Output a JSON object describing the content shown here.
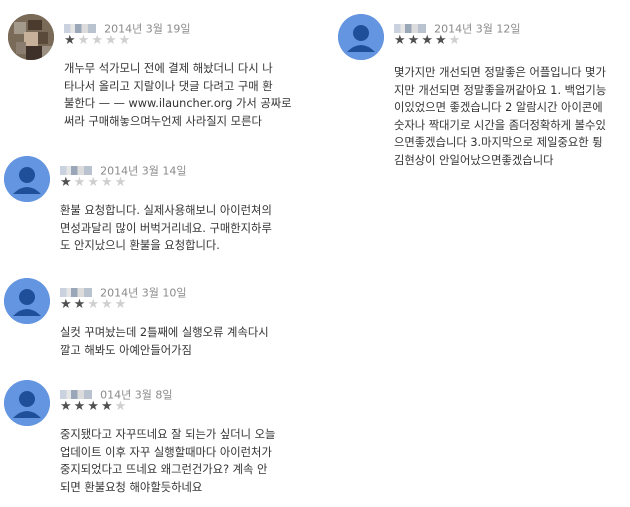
{
  "reviews": [
    {
      "avatar": "photo-avatar",
      "date": "2014년 3월 19일",
      "rating": 1,
      "lines": [
        "개누무 석가모니 전에 결제 해놨더니 다시 나",
        "타나서 올리고 지랄이나 댓글 다려고 구매 환",
        "불한다 — — www.ilauncher.org 가서 공짜로",
        "써라 구매해놓으며누언제 사라질지 모른다"
      ]
    },
    {
      "avatar": "default-user-avatar",
      "date": "2014년 3월 14일",
      "rating": 1,
      "lines": [
        "환불 요청합니다. 실제사용해보니 아이런쳐의",
        "면성과달리 많이 버벅거리네요. 구매한지하루",
        "도 안지났으니 환불을 요청합니다."
      ]
    },
    {
      "avatar": "default-user-avatar",
      "date": "2014년 3월 10일",
      "rating": 2,
      "lines": [
        "실컷 꾸며놨는데 2틀째에 실행오류 계속다시",
        "깔고 해봐도 아예안들어가짐"
      ]
    },
    {
      "avatar": "default-user-avatar",
      "date": "014년 3월 8일",
      "rating": 4,
      "lines": [
        "중지됐다고 자꾸뜨네요 잘 되는가 싶더니 오늘",
        "업데이트 이후 자꾸 실행할때마다 아이런처가",
        "중지되었다고 뜨네요 왜그런건가요? 계속 안",
        "되면 환불요청 해야할듯하네요"
      ]
    },
    {
      "avatar": "default-user-avatar",
      "date": "2014년 3월 12일",
      "rating": 4,
      "lines": [
        "몇가지만 개선되면 정말좋은 어플입니다 몇가",
        "지만 개선되면 정말좋을꺼같아요 1. 백업기능",
        "이있었으면 좋겠습니다 2 알람시간 아이콘에",
        "숫자나 짝대기로 시간을 좀더정확하게 볼수있",
        "으면좋겠습니다 3.마지막으로 제일중요한 튕",
        "김현상이 안일어났으면좋겠습니다"
      ]
    }
  ]
}
